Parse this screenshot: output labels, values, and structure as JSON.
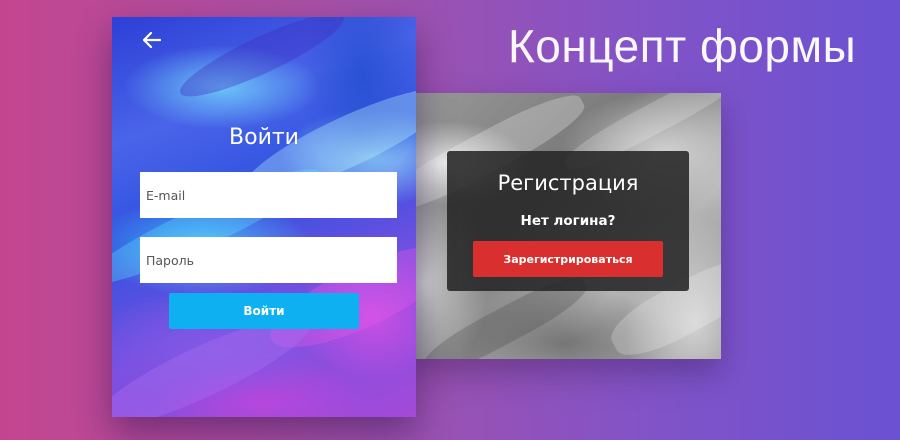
{
  "page": {
    "title": "Концепт формы",
    "background_colors": [
      "#c4458f",
      "#6a52d2"
    ]
  },
  "login": {
    "back_icon": "arrow-left-icon",
    "title": "Войти",
    "email_placeholder": "E-mail",
    "password_placeholder": "Пароль",
    "submit_label": "Войти",
    "submit_color": "#0fb0f2"
  },
  "register": {
    "title": "Регистрация",
    "question": "Нет логина?",
    "submit_label": "Зарегистрироваться",
    "submit_color": "#d9302f"
  }
}
